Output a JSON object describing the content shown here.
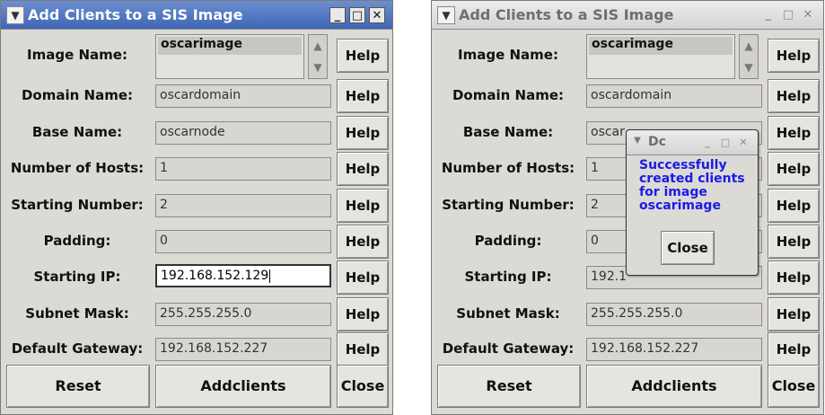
{
  "window_title": "Add Clients to a SIS Image",
  "titlebar_icons": {
    "menu": "chevron-down-icon",
    "minimize": "minimize-icon",
    "maximize": "maximize-icon",
    "close": "close-icon"
  },
  "form": {
    "image_label": "Image Name:",
    "image_value": "oscarimage",
    "domain_label": "Domain Name:",
    "domain_value": "oscardomain",
    "base_label": "Base Name:",
    "base_value": "oscarnode",
    "base_value_partial": "oscar",
    "hosts_label": "Number of Hosts:",
    "hosts_value": "1",
    "start_label": "Starting Number:",
    "start_value": "2",
    "padding_label": "Padding:",
    "padding_value": "0",
    "ip_label": "Starting IP:",
    "ip_value": "192.168.152.129",
    "ip_value_partial": "192.1",
    "subnet_label": "Subnet Mask:",
    "subnet_value": "255.255.255.0",
    "gateway_label": "Default Gateway:",
    "gateway_value": "192.168.152.227",
    "help_label": "Help"
  },
  "buttons": {
    "reset": "Reset",
    "addclients": "Addclients",
    "close": "Close"
  },
  "dialog": {
    "title": "Dc",
    "message": "Successfully created clients for image oscarimage",
    "close": "Close"
  },
  "colors": {
    "active_titlebar": "#4a70bf",
    "dialog_text": "#1a1ae8",
    "window_bg": "#dcdad5"
  }
}
